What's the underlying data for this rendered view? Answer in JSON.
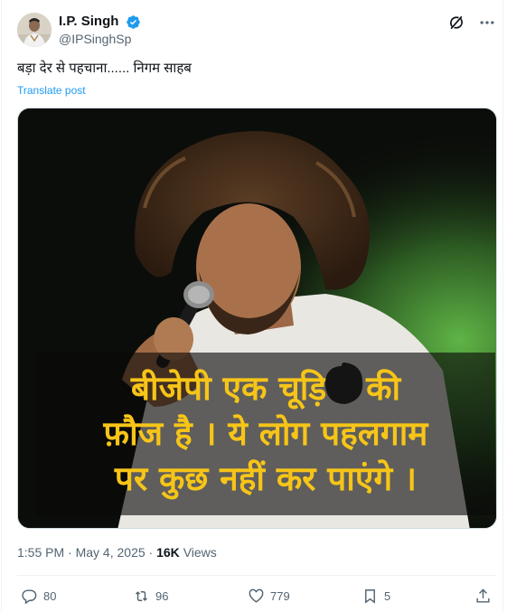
{
  "post": {
    "author": {
      "display_name": "I.P. Singh",
      "handle": "@IPSinghSp",
      "verified": true
    },
    "text": "बड़ा देर से पहचाना...... निगम साहब",
    "translate_label": "Translate post",
    "image_caption": {
      "line1": "बीजेपी एक चूड़ियों की",
      "line2": "फ़ौज है । ये लोग पहलगाम",
      "line3": "पर कुछ नहीं कर पाएंगे ।"
    },
    "time": "1:55 PM",
    "separator": "·",
    "date": "May 4, 2025",
    "views_count": "16K",
    "views_label": "Views",
    "stats": {
      "replies": "80",
      "reposts": "96",
      "likes": "779",
      "bookmarks": "5"
    }
  },
  "colors": {
    "accent": "#1d9bf0",
    "secondary_text": "#536471",
    "caption_text": "#f7c518"
  },
  "icons": [
    "verified-badge-icon",
    "grok-icon",
    "more-icon",
    "reply-icon",
    "repost-icon",
    "like-icon",
    "bookmark-icon",
    "share-icon"
  ]
}
